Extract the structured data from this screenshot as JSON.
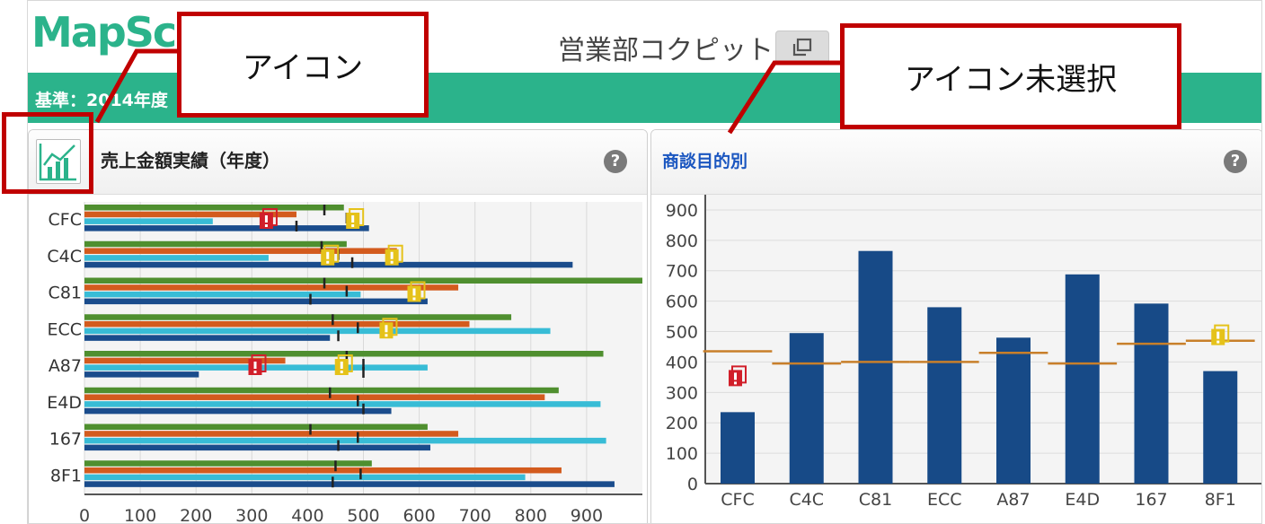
{
  "header": {
    "logo_text": "MapSc",
    "cockpit_title": "営業部コクピット",
    "basis_text": "基準：2014年度",
    "accent_color": "#2bb38b"
  },
  "left_panel": {
    "title": "売上金額実績（年度）",
    "help_symbol": "?"
  },
  "right_panel": {
    "title": "商談目的別",
    "help_symbol": "?"
  },
  "callouts": {
    "icon_label": "アイコン",
    "unselected_label": "アイコン未選択",
    "callout_color": "#c00000"
  },
  "chart_data": [
    {
      "type": "bar",
      "orientation": "horizontal",
      "categories": [
        "CFC",
        "C4C",
        "C81",
        "ECC",
        "A87",
        "E4D",
        "167",
        "8F1"
      ],
      "xlim": [
        0,
        1000
      ],
      "x_ticks": [
        0,
        100,
        200,
        300,
        400,
        500,
        600,
        700,
        800,
        900
      ],
      "grid": true,
      "series": [
        {
          "color": "#4f8f2f",
          "values": [
            465,
            470,
            1000,
            765,
            930,
            850,
            615,
            515
          ]
        },
        {
          "color": "#d35b1e",
          "values": [
            380,
            560,
            670,
            690,
            360,
            825,
            670,
            855
          ]
        },
        {
          "color": "#38bcd6",
          "values": [
            230,
            330,
            495,
            835,
            615,
            925,
            935,
            790
          ]
        },
        {
          "color": "#1a4c8c",
          "values": [
            510,
            875,
            615,
            440,
            205,
            550,
            620,
            950
          ]
        }
      ],
      "target_markers": [
        [
          430,
          470,
          380
        ],
        [
          425,
          455,
          480
        ],
        [
          430,
          470,
          405
        ],
        [
          445,
          490,
          455
        ],
        [
          470,
          500,
          500
        ],
        [
          440,
          490,
          500
        ],
        [
          405,
          490,
          455
        ],
        [
          450,
          495,
          445
        ]
      ],
      "status_icons": [
        {
          "category": "CFC",
          "value": 330,
          "status": "red"
        },
        {
          "category": "CFC",
          "value": 485,
          "status": "yellow"
        },
        {
          "category": "C4C",
          "value": 440,
          "status": "yellow"
        },
        {
          "category": "C4C",
          "value": 555,
          "status": "yellow"
        },
        {
          "category": "C81",
          "value": 595,
          "status": "yellow"
        },
        {
          "category": "ECC",
          "value": 545,
          "status": "yellow"
        },
        {
          "category": "A87",
          "value": 465,
          "status": "yellow"
        },
        {
          "category": "A87",
          "value": 310,
          "status": "red"
        }
      ]
    },
    {
      "type": "bar",
      "categories": [
        "CFC",
        "C4C",
        "C81",
        "ECC",
        "A87",
        "E4D",
        "167",
        "8F1"
      ],
      "values": [
        235,
        495,
        765,
        580,
        480,
        688,
        592,
        370
      ],
      "targets": [
        435,
        395,
        400,
        400,
        430,
        395,
        460,
        470
      ],
      "bar_color": "#174a87",
      "target_color": "#c87f2a",
      "ylim": [
        0,
        950
      ],
      "y_ticks": [
        0,
        100,
        200,
        300,
        400,
        500,
        600,
        700,
        800,
        900
      ],
      "grid": true,
      "status_icons": [
        {
          "category": "CFC",
          "value": 350,
          "status": "red"
        },
        {
          "category": "8F1",
          "value": 485,
          "status": "yellow"
        }
      ]
    }
  ]
}
